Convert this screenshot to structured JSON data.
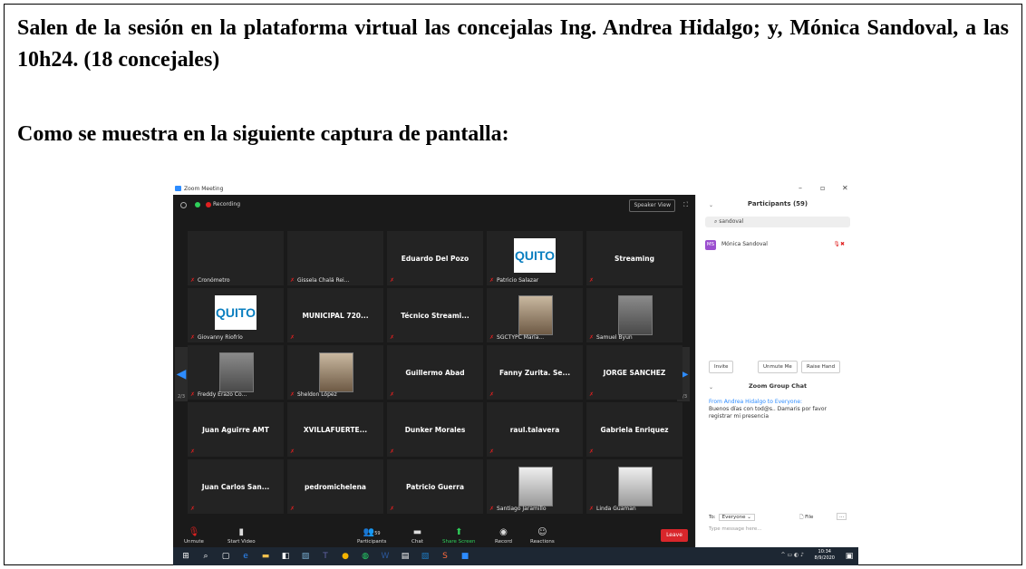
{
  "document": {
    "paragraph1": "Salen de la sesión en la plataforma virtual las concejalas Ing. Andrea Hidalgo; y, Mónica Sandoval, a las 10h24. (18 concejales)",
    "paragraph2": "Como se muestra en la siguiente captura de pantalla:"
  },
  "screenshot": {
    "window_title": "Zoom Meeting",
    "recording_label": "Recording",
    "speaker_view_label": "Speaker View",
    "page_indicator_left": "2/3",
    "page_indicator_right": "2/3",
    "tiles": [
      {
        "name": "",
        "label": "Cronómetro"
      },
      {
        "name": "",
        "label": "Gissela Chalá Rei..."
      },
      {
        "name": "Eduardo Del Pozo",
        "label": ""
      },
      {
        "name": "",
        "label": "Patricio Salazar",
        "logo": "QUITO"
      },
      {
        "name": "Streaming",
        "label": ""
      },
      {
        "name": "",
        "label": "Giovanny Riofrío",
        "logo": "QUITO"
      },
      {
        "name": "MUNICIPAL 720...",
        "label": ""
      },
      {
        "name": "Técnico Streami...",
        "label": ""
      },
      {
        "name": "",
        "label": "SGCTYPC  María..."
      },
      {
        "name": "",
        "label": "Samuel Byun"
      },
      {
        "name": "",
        "label": "Freddy Erazo Co..."
      },
      {
        "name": "",
        "label": "Sheldon López"
      },
      {
        "name": "Guillermo Abad",
        "label": ""
      },
      {
        "name": "Fanny  Zurita. Se...",
        "label": ""
      },
      {
        "name": "JORGE SANCHEZ",
        "label": ""
      },
      {
        "name": "Juan Aguirre AMT",
        "label": ""
      },
      {
        "name": "XVILLAFUERTE...",
        "label": ""
      },
      {
        "name": "Dunker Morales",
        "label": ""
      },
      {
        "name": "raul.talavera",
        "label": ""
      },
      {
        "name": "Gabriela Enriquez",
        "label": ""
      },
      {
        "name": "Juan Carlos San...",
        "label": ""
      },
      {
        "name": "pedromichelena",
        "label": ""
      },
      {
        "name": "Patricio Guerra",
        "label": ""
      },
      {
        "name": "",
        "label": "Santiago Jaramillo"
      },
      {
        "name": "",
        "label": "Linda Guaman"
      }
    ],
    "toolbar": {
      "unmute": "Unmute",
      "start_video": "Start Video",
      "participants": "Participants",
      "participants_count": "59",
      "chat": "Chat",
      "share_screen": "Share Screen",
      "record": "Record",
      "reactions": "Reactions",
      "leave": "Leave"
    },
    "participants_panel": {
      "title": "Participants (59)",
      "search_value": "sandoval",
      "participant_initials": "MS",
      "participant_name": "Mónica Sandoval",
      "invite": "Invite",
      "unmute_me": "Unmute Me",
      "raise_hand": "Raise Hand"
    },
    "chat_panel": {
      "title": "Zoom Group Chat",
      "from_prefix": "From",
      "from_name": "Andrea Hidalgo",
      "to_word": "to",
      "to_name": "Everyone:",
      "message": "Buenos días con tod@s.. Damaris por favor registrar mi presencia",
      "to_label": "To:",
      "to_value": "Everyone",
      "file_label": "File",
      "more_label": "...",
      "type_placeholder": "Type message here..."
    },
    "taskbar": {
      "time": "10:34",
      "date": "8/9/2020"
    }
  }
}
